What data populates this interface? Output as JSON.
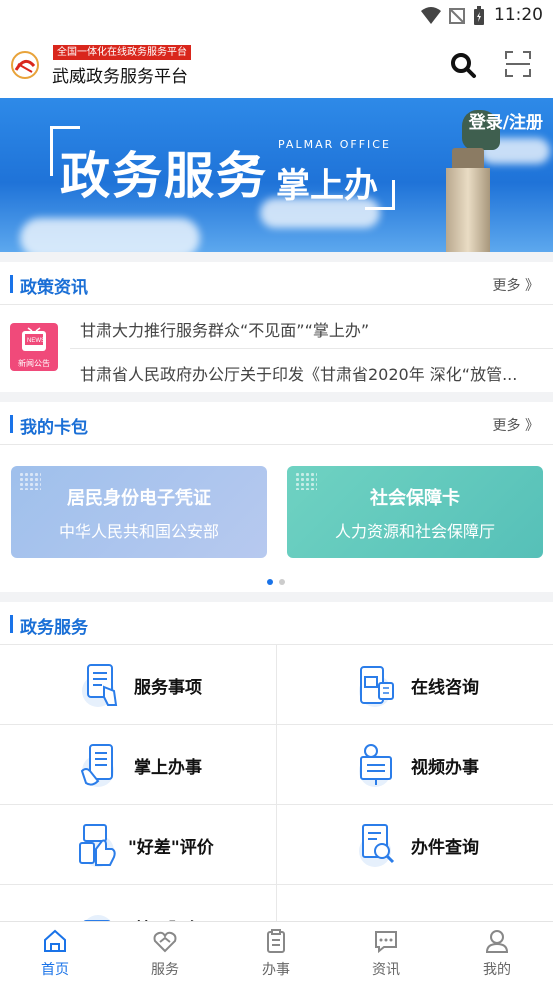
{
  "status_bar": {
    "time": "11:20"
  },
  "header": {
    "tagline": "全国一体化在线政务服务平台",
    "title": "武威政务服务平台"
  },
  "banner": {
    "login": "登录/注册",
    "title_main": "政务服务",
    "title_sub": "掌上办",
    "subtitle_en": "PALMAR OFFICE"
  },
  "policy": {
    "title": "政策资讯",
    "more": "更多 》",
    "news_icon_label": "新闻公告",
    "items": [
      "甘肃大力推行服务群众“不见面”“掌上办”",
      "甘肃省人民政府办公厅关于印发《甘肃省2020年 深化“放管..."
    ]
  },
  "wallet": {
    "title": "我的卡包",
    "more": "更多 》",
    "cards": [
      {
        "name": "居民身份电子凭证",
        "org": "中华人民共和国公安部",
        "color": "#8fb4e8"
      },
      {
        "name": "社会保障卡",
        "org": "人力资源和社会保障厅",
        "color": "#5fc9b9"
      }
    ],
    "page_index": 1,
    "page_count": 2
  },
  "services": {
    "title": "政务服务",
    "items": [
      {
        "label": "服务事项",
        "icon": "service-items-icon"
      },
      {
        "label": "在线咨询",
        "icon": "online-consult-icon"
      },
      {
        "label": "掌上办事",
        "icon": "mobile-affairs-icon"
      },
      {
        "label": "视频办事",
        "icon": "video-affairs-icon"
      },
      {
        "label": "\"好差\"评价",
        "icon": "rating-icon"
      },
      {
        "label": "办件查询",
        "icon": "case-query-icon"
      },
      {
        "label": "基层服务",
        "icon": "grassroots-icon"
      }
    ]
  },
  "tabbar": {
    "tabs": [
      {
        "label": "首页",
        "icon": "home-icon",
        "active": true
      },
      {
        "label": "服务",
        "icon": "service-icon",
        "active": false
      },
      {
        "label": "办事",
        "icon": "affairs-icon",
        "active": false
      },
      {
        "label": "资讯",
        "icon": "news-icon",
        "active": false
      },
      {
        "label": "我的",
        "icon": "profile-icon",
        "active": false
      }
    ]
  },
  "colors": {
    "accent": "#1a73e8",
    "tagline_red": "#d9261c"
  }
}
